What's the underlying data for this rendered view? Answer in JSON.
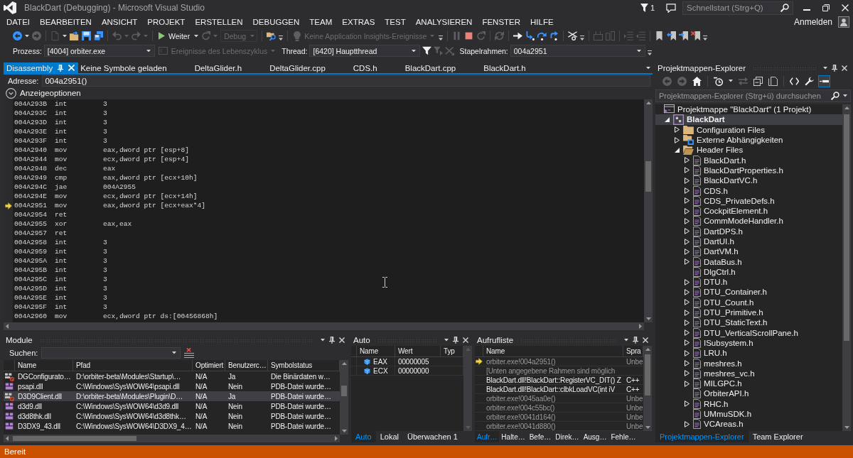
{
  "window": {
    "title": "BlackDart (Debugging) - Microsoft Visual Studio",
    "notification_count": "1",
    "quick_launch": {
      "placeholder": "Schnellstart (Strg+Q)"
    },
    "account": "Anmelden"
  },
  "menu": [
    "DATEI",
    "BEARBEITEN",
    "ANSICHT",
    "PROJEKT",
    "ERSTELLEN",
    "DEBUGGEN",
    "TEAM",
    "EXTRAS",
    "TEST",
    "ANALYSIEREN",
    "FENSTER",
    "HILFE"
  ],
  "standard_toolbar": {
    "groups": [
      {
        "overflow": false,
        "items": [
          {
            "kind": "back",
            "disabled": false
          },
          {
            "kind": "caret",
            "disabled": false
          },
          {
            "kind": "forward",
            "disabled": true
          }
        ]
      },
      {
        "overflow": false,
        "items": [
          {
            "kind": "newitem",
            "disabled": true
          },
          {
            "kind": "caret",
            "disabled": false
          },
          {
            "kind": "open",
            "disabled": false
          },
          {
            "kind": "save",
            "disabled": false
          },
          {
            "kind": "saveall",
            "disabled": false
          }
        ]
      },
      {
        "overflow": false,
        "items": [
          {
            "kind": "undo",
            "disabled": true
          },
          {
            "kind": "caret",
            "disabled": true
          },
          {
            "kind": "redo",
            "disabled": true
          },
          {
            "kind": "caret",
            "disabled": true
          }
        ]
      },
      {
        "overflow": false,
        "items": [
          {
            "kind": "continue",
            "label": "Weiter",
            "disabled": false
          },
          {
            "kind": "caret",
            "disabled": false
          },
          {
            "kind": "restart",
            "disabled": true
          },
          {
            "kind": "caret",
            "disabled": true
          },
          {
            "kind": "combo",
            "label": "Debug",
            "disabled": true
          }
        ]
      },
      {
        "overflow": true,
        "items": [
          {
            "kind": "find",
            "disabled": false
          }
        ]
      },
      {
        "overflow": true,
        "items": [
          {
            "kind": "insights",
            "label": "Keine Application Insights-Ereignisse",
            "disabled": true
          }
        ]
      },
      {
        "overflow": false,
        "items": [
          {
            "kind": "pause",
            "disabled": true
          },
          {
            "kind": "stop",
            "disabled": false
          },
          {
            "kind": "restart",
            "disabled": true
          }
        ]
      },
      {
        "overflow": false,
        "items": [
          {
            "kind": "threads",
            "disabled": true
          }
        ]
      },
      {
        "overflow": false,
        "items": [
          {
            "kind": "next",
            "disabled": false
          },
          {
            "kind": "stepinto",
            "disabled": false
          },
          {
            "kind": "stepover",
            "disabled": false
          },
          {
            "kind": "stepout",
            "disabled": false
          }
        ]
      },
      {
        "overflow": true,
        "items": [
          {
            "kind": "hex",
            "disabled": false
          }
        ]
      },
      {
        "overflow": false,
        "items": [
          {
            "kind": "block",
            "disabled": true
          },
          {
            "kind": "columns",
            "disabled": true
          }
        ]
      },
      {
        "overflow": false,
        "items": [
          {
            "kind": "comment",
            "disabled": true
          },
          {
            "kind": "uncomment",
            "disabled": true
          }
        ]
      },
      {
        "overflow": true,
        "items": [
          {
            "kind": "bookmark",
            "disabled": false
          },
          {
            "kind": "prevbookmark",
            "disabled": false
          },
          {
            "kind": "nextbookmark",
            "disabled": false
          },
          {
            "kind": "clearbookmarks",
            "disabled": false
          }
        ]
      }
    ]
  },
  "debug_location": {
    "process": {
      "label": "Prozess:",
      "value": "[4004] orbiter.exe"
    },
    "lifecycle": {
      "label": "Ereignisse des Lebenszyklus",
      "disabled": true
    },
    "thread": {
      "label": "Thread:",
      "value": "[6420] Hauptthread"
    },
    "thread_tools": [
      {
        "kind": "filter",
        "disabled": false
      },
      {
        "kind": "flagged",
        "disabled": true
      },
      {
        "kind": "flagall",
        "disabled": true
      }
    ],
    "stack_frame": {
      "label": "Stapelrahmen:",
      "value": "004a2951"
    }
  },
  "document_tabs": [
    {
      "label": "Disassembly",
      "selected": true
    },
    {
      "label": "Keine Symbole geladen",
      "selected": false
    },
    {
      "label": "DeltaGlider.h",
      "selected": false
    },
    {
      "label": "DeltaGlider.cpp",
      "selected": false
    },
    {
      "label": "CDS.h",
      "selected": false
    },
    {
      "label": "BlackDart.cpp",
      "selected": false
    },
    {
      "label": "BlackDart.h",
      "selected": false
    }
  ],
  "disassembly": {
    "address_label": "Adresse:",
    "address": "004a2951()",
    "view_options": "Anzeigeoptionen",
    "lines": [
      {
        "address": "004A293B",
        "mnemonic": "int",
        "operands": "3",
        "current": false
      },
      {
        "address": "004A293C",
        "mnemonic": "int",
        "operands": "3",
        "current": false
      },
      {
        "address": "004A293D",
        "mnemonic": "int",
        "operands": "3",
        "current": false
      },
      {
        "address": "004A293E",
        "mnemonic": "int",
        "operands": "3",
        "current": false
      },
      {
        "address": "004A293F",
        "mnemonic": "int",
        "operands": "3",
        "current": false
      },
      {
        "address": "004A2940",
        "mnemonic": "mov",
        "operands": "eax,dword ptr [esp+8]",
        "current": false
      },
      {
        "address": "004A2944",
        "mnemonic": "mov",
        "operands": "ecx,dword ptr [esp+4]",
        "current": false
      },
      {
        "address": "004A2948",
        "mnemonic": "dec",
        "operands": "eax",
        "current": false
      },
      {
        "address": "004A2949",
        "mnemonic": "cmp",
        "operands": "eax,dword ptr [ecx+10h]",
        "current": false
      },
      {
        "address": "004A294C",
        "mnemonic": "jae",
        "operands": "004A2955",
        "current": false
      },
      {
        "address": "004A294E",
        "mnemonic": "mov",
        "operands": "ecx,dword ptr [ecx+14h]",
        "current": false
      },
      {
        "address": "004A2951",
        "mnemonic": "mov",
        "operands": "eax,dword ptr [ecx+eax*4]",
        "current": true
      },
      {
        "address": "004A2954",
        "mnemonic": "ret",
        "current": false
      },
      {
        "address": "004A2955",
        "mnemonic": "xor",
        "operands": "eax,eax",
        "current": false
      },
      {
        "address": "004A2957",
        "mnemonic": "ret",
        "current": false
      },
      {
        "address": "004A2958",
        "mnemonic": "int",
        "operands": "3",
        "current": false
      },
      {
        "address": "004A2959",
        "mnemonic": "int",
        "operands": "3",
        "current": false
      },
      {
        "address": "004A295A",
        "mnemonic": "int",
        "operands": "3",
        "current": false
      },
      {
        "address": "004A295B",
        "mnemonic": "int",
        "operands": "3",
        "current": false
      },
      {
        "address": "004A295C",
        "mnemonic": "int",
        "operands": "3",
        "current": false
      },
      {
        "address": "004A295D",
        "mnemonic": "int",
        "operands": "3",
        "current": false
      },
      {
        "address": "004A295E",
        "mnemonic": "int",
        "operands": "3",
        "current": false
      },
      {
        "address": "004A295F",
        "mnemonic": "int",
        "operands": "3",
        "current": false
      },
      {
        "address": "004A2960",
        "mnemonic": "mov",
        "operands": "ecx,dword ptr ds:[00456868h]",
        "current": false
      }
    ]
  },
  "modules": {
    "title": "Module",
    "search_label": "Suchen:",
    "columns": [
      "Name",
      "Pfad",
      "Optimiert",
      "Benutzerc…",
      "Symbolstatus"
    ],
    "rows": [
      {
        "kind": "user",
        "selected": false,
        "cells": [
          "DGConfigurato…",
          "D:\\orbiter-beta\\Modules\\Startup\\…",
          "N/A",
          "Ja",
          "Die Binärdaten w…"
        ]
      },
      {
        "kind": "system",
        "selected": false,
        "cells": [
          "psapi.dll",
          "C:\\Windows\\SysWOW64\\psapi.dll",
          "N/A",
          "Nein",
          "PDB-Datei wurde…"
        ]
      },
      {
        "kind": "user",
        "selected": true,
        "cells": [
          "D3D9Client.dll",
          "D:\\orbiter-beta\\Modules\\Plugin\\D…",
          "N/A",
          "Ja",
          "PDB-Datei wurde…"
        ]
      },
      {
        "kind": "system",
        "selected": false,
        "cells": [
          "d3d9.dll",
          "C:\\Windows\\SysWOW64\\d3d9.dll",
          "N/A",
          "Nein",
          "PDB-Datei wurde…"
        ]
      },
      {
        "kind": "system",
        "selected": false,
        "cells": [
          "d3d8thk.dll",
          "C:\\Windows\\SysWOW64\\d3d8thk…",
          "N/A",
          "Nein",
          "PDB-Datei wurde…"
        ]
      },
      {
        "kind": "system",
        "selected": false,
        "cells": [
          "D3DX9_43.dll",
          "C:\\Windows\\SysWOW64\\D3DX9_4…",
          "N/A",
          "Nein",
          "PDB-Datei wurde…"
        ]
      }
    ]
  },
  "autos": {
    "title": "Auto",
    "columns": [
      "Name",
      "Wert",
      "Typ"
    ],
    "rows": [
      {
        "name": "EAX",
        "value": "00000005"
      },
      {
        "name": "ECX",
        "value": "00000000"
      }
    ],
    "tabs": [
      {
        "label": "Auto",
        "selected": true
      },
      {
        "label": "Lokal",
        "selected": false
      },
      {
        "label": "Überwachen 1",
        "selected": false
      }
    ]
  },
  "call_stack": {
    "title": "Aufrufliste",
    "columns": [
      "Name",
      "Spra"
    ],
    "rows": [
      {
        "name": "orbiter.exe!004a2951()",
        "language": "Unbe",
        "current": true,
        "dimmed": true
      },
      {
        "name": "[Unten angegebene Rahmen sind möglich",
        "current": false,
        "dimmed": true
      },
      {
        "name": "BlackDart.dll!BlackDart::RegisterVC_DIT() Z",
        "language": "C++",
        "current": false,
        "dimmed": false
      },
      {
        "name": "BlackDart.dll!BlackDart::clbkLoadVC(int iV",
        "language": "C++",
        "current": false,
        "dimmed": false
      },
      {
        "name": "orbiter.exe!0045aa0e()",
        "language": "Unbe",
        "current": false,
        "dimmed": true
      },
      {
        "name": "orbiter.exe!004c55bc()",
        "language": "Unbe",
        "current": false,
        "dimmed": true
      },
      {
        "name": "orbiter.exe!0041d164()",
        "language": "Unbe",
        "current": false,
        "dimmed": true
      },
      {
        "name": "orbiter.exe!0041d880()",
        "language": "Unbe",
        "current": false,
        "dimmed": true
      }
    ],
    "tabs": [
      {
        "label": "Aufr…",
        "selected": true
      },
      {
        "label": "Halte…",
        "selected": false
      },
      {
        "label": "Befe…",
        "selected": false
      },
      {
        "label": "Direk…",
        "selected": false
      },
      {
        "label": "Ausg…",
        "selected": false
      },
      {
        "label": "Fehle…",
        "selected": false
      }
    ]
  },
  "solution_explorer": {
    "title": "Projektmappen-Explorer",
    "toolbar": {
      "groups": [
        {
          "items": [
            {
              "kind": "back",
              "disabled": true,
              "on": false
            },
            {
              "kind": "forward",
              "disabled": true,
              "on": false
            },
            {
              "kind": "home",
              "disabled": false,
              "on": false
            }
          ]
        },
        {
          "items": [
            {
              "kind": "history",
              "disabled": false,
              "on": false
            },
            {
              "kind": "caret",
              "disabled": false,
              "on": false
            },
            {
              "kind": "sync",
              "disabled": true,
              "on": false
            },
            {
              "kind": "collapse",
              "disabled": false,
              "on": false
            },
            {
              "kind": "showall",
              "disabled": false,
              "on": false
            }
          ]
        },
        {
          "items": [
            {
              "kind": "code",
              "disabled": false,
              "on": false
            },
            {
              "kind": "properties",
              "disabled": false,
              "on": false
            },
            {
              "kind": "preview",
              "disabled": false,
              "on": true
            }
          ]
        }
      ]
    },
    "search": {
      "placeholder": "Projektmappen-Explorer (Strg+ü) durchsuchen"
    },
    "tree": [
      {
        "label": "Projektmappe \"BlackDart\" (1 Projekt)",
        "kind": "solution",
        "expandable": false,
        "expanded": true,
        "selected": false,
        "children": [
          {
            "label": "BlackDart",
            "kind": "project",
            "expandable": true,
            "expanded": true,
            "selected": true,
            "children": [
              {
                "label": "Configuration Files",
                "kind": "folder",
                "expandable": true,
                "expanded": false,
                "selected": false
              },
              {
                "label": "Externe Abhängigkeiten",
                "kind": "references",
                "expandable": true,
                "expanded": false,
                "selected": false
              },
              {
                "label": "Header Files",
                "kind": "folder",
                "expandable": true,
                "expanded": true,
                "selected": false,
                "children": [
                  {
                    "label": "BlackDart.h",
                    "kind": "header",
                    "expandable": true,
                    "expanded": false,
                    "selected": false
                  },
                  {
                    "label": "BlackDartProperties.h",
                    "kind": "header",
                    "expandable": true,
                    "expanded": false,
                    "selected": false
                  },
                  {
                    "label": "BlackDartVC.h",
                    "kind": "header",
                    "expandable": true,
                    "expanded": false,
                    "selected": false
                  },
                  {
                    "label": "CDS.h",
                    "kind": "header",
                    "expandable": true,
                    "expanded": false,
                    "selected": false
                  },
                  {
                    "label": "CDS_PrivateDefs.h",
                    "kind": "header",
                    "expandable": true,
                    "expanded": false,
                    "selected": false
                  },
                  {
                    "label": "CockpitElement.h",
                    "kind": "header",
                    "expandable": true,
                    "expanded": false,
                    "selected": false
                  },
                  {
                    "label": "CommModeHandler.h",
                    "kind": "header",
                    "expandable": true,
                    "expanded": false,
                    "selected": false
                  },
                  {
                    "label": "DartDPS.h",
                    "kind": "header",
                    "expandable": true,
                    "expanded": false,
                    "selected": false
                  },
                  {
                    "label": "DartUI.h",
                    "kind": "header",
                    "expandable": true,
                    "expanded": false,
                    "selected": false
                  },
                  {
                    "label": "DartVM.h",
                    "kind": "header",
                    "expandable": true,
                    "expanded": false,
                    "selected": false
                  },
                  {
                    "label": "DataBus.h",
                    "kind": "header",
                    "expandable": true,
                    "expanded": false,
                    "selected": false
                  },
                  {
                    "label": "DlgCtrl.h",
                    "kind": "header",
                    "expandable": false,
                    "expanded": false,
                    "selected": false
                  },
                  {
                    "label": "DTU.h",
                    "kind": "header",
                    "expandable": true,
                    "expanded": false,
                    "selected": false
                  },
                  {
                    "label": "DTU_Container.h",
                    "kind": "header",
                    "expandable": true,
                    "expanded": false,
                    "selected": false
                  },
                  {
                    "label": "DTU_Count.h",
                    "kind": "header",
                    "expandable": true,
                    "expanded": false,
                    "selected": false
                  },
                  {
                    "label": "DTU_Primitive.h",
                    "kind": "header",
                    "expandable": true,
                    "expanded": false,
                    "selected": false
                  },
                  {
                    "label": "DTU_StaticText.h",
                    "kind": "header",
                    "expandable": true,
                    "expanded": false,
                    "selected": false
                  },
                  {
                    "label": "DTU_VerticalScrollPane.h",
                    "kind": "header",
                    "expandable": true,
                    "expanded": false,
                    "selected": false
                  },
                  {
                    "label": "ISubsystem.h",
                    "kind": "header",
                    "expandable": true,
                    "expanded": false,
                    "selected": false
                  },
                  {
                    "label": "LRU.h",
                    "kind": "header",
                    "expandable": true,
                    "expanded": false,
                    "selected": false
                  },
                  {
                    "label": "meshres.h",
                    "kind": "header",
                    "expandable": true,
                    "expanded": false,
                    "selected": false
                  },
                  {
                    "label": "meshres_vc.h",
                    "kind": "header",
                    "expandable": true,
                    "expanded": false,
                    "selected": false
                  },
                  {
                    "label": "MILGPC.h",
                    "kind": "header",
                    "expandable": true,
                    "expanded": false,
                    "selected": false
                  },
                  {
                    "label": "OrbiterAPI.h",
                    "kind": "header",
                    "expandable": false,
                    "expanded": false,
                    "selected": false
                  },
                  {
                    "label": "RHC.h",
                    "kind": "header",
                    "expandable": true,
                    "expanded": false,
                    "selected": false
                  },
                  {
                    "label": "UMmuSDK.h",
                    "kind": "header",
                    "expandable": false,
                    "expanded": false,
                    "selected": false
                  },
                  {
                    "label": "VCAreas.h",
                    "kind": "header",
                    "expandable": true,
                    "expanded": false,
                    "selected": false
                  }
                ]
              }
            ]
          }
        ]
      }
    ],
    "tabs": [
      {
        "label": "Projektmappen-Explorer",
        "selected": true
      },
      {
        "label": "Team Explorer",
        "selected": false
      }
    ]
  },
  "status_bar": {
    "text": "Bereit"
  }
}
